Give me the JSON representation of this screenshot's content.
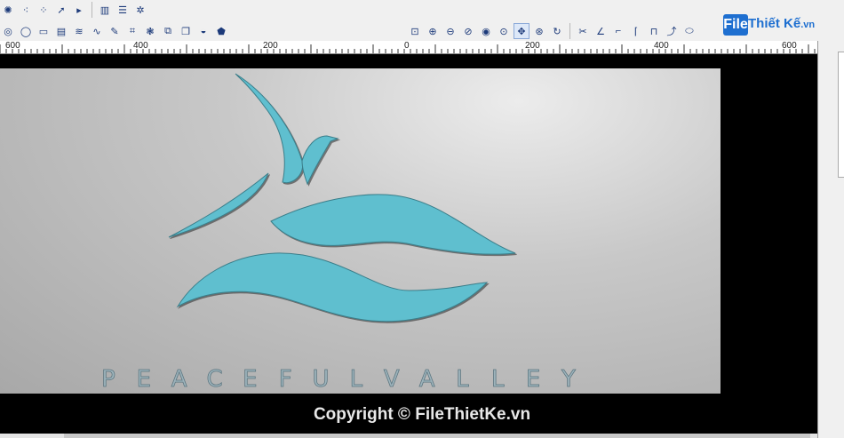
{
  "toolbar_top": {
    "left_icons": [
      "bulb-icon",
      "dots-icon",
      "marker-icon",
      "arrow-icon",
      "page-icon",
      "bars-icon",
      "gear-icon"
    ]
  },
  "toolbar_second": {
    "left_icons": [
      "circle-tool-icon",
      "oval-tool-icon",
      "rect-tool-icon",
      "grid-tool-icon",
      "curve-tool-icon",
      "wave-tool-icon",
      "knot-tool-icon",
      "table-tool-icon",
      "star-tool-icon",
      "copy-tool-icon",
      "copy2-tool-icon",
      "shield-tool-icon",
      "badge-tool-icon"
    ],
    "view_icons": [
      "zoom-select-icon",
      "zoom-in-icon",
      "zoom-out-icon",
      "zoom-fit-icon",
      "zoom-all-icon",
      "zoom-prev-icon",
      "pan-icon",
      "zoom-icon",
      "refresh-icon",
      "cut-tool-icon",
      "angle-tool-icon",
      "corner-tool-icon",
      "corner2-tool-icon",
      "square-tool-icon",
      "path-tool-icon",
      "ellipse-tool-icon"
    ]
  },
  "ruler": {
    "labels": [
      "600",
      "400",
      "200",
      "0",
      "200",
      "400",
      "600"
    ]
  },
  "artwork": {
    "title_letters": [
      "P",
      "E",
      "A",
      "C",
      "E",
      "F",
      "U",
      "L",
      "V",
      "A",
      "L",
      "L",
      "E",
      "Y"
    ],
    "fill_color": "#5fbfcf",
    "plate_color": "#c0c0c0"
  },
  "watermark": {
    "logo_box": "File",
    "logo_text": "Thiết Kế",
    "logo_suffix": ".vn",
    "copyright": "Copyright © FileThietKe.vn"
  }
}
